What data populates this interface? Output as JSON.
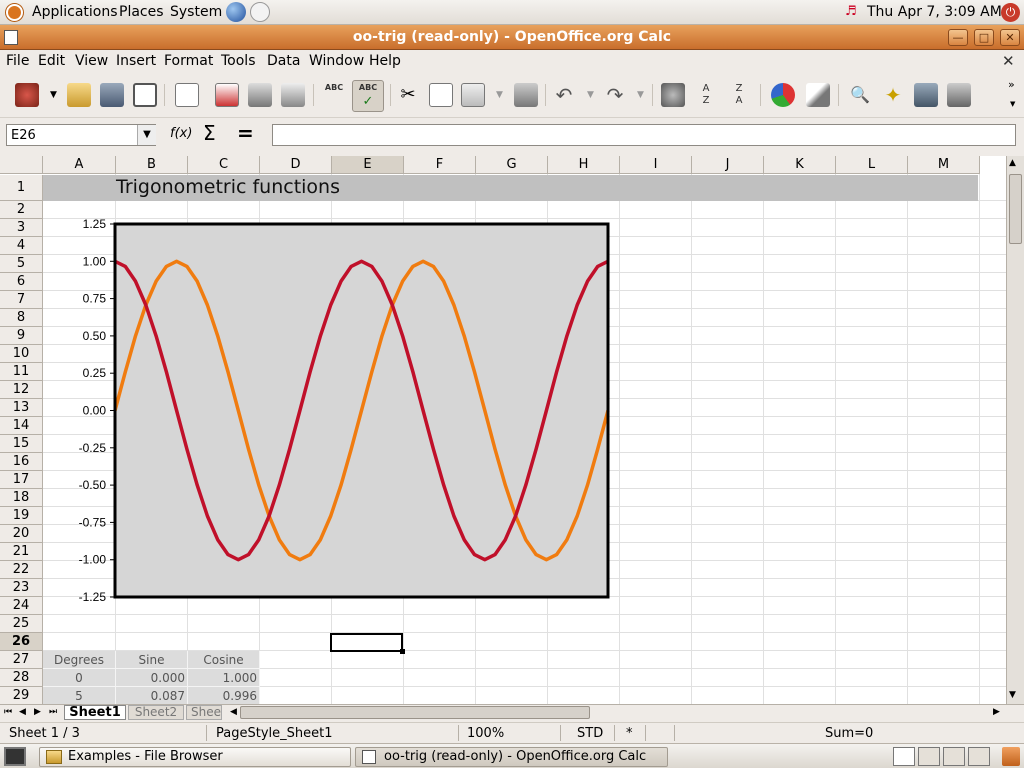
{
  "top_panel": {
    "applications": "Applications",
    "places": "Places",
    "system": "System",
    "clock": "Thu Apr  7,  3:09 AM"
  },
  "window": {
    "title": "oo-trig (read-only) - OpenOffice.org Calc"
  },
  "menu": [
    "File",
    "Edit",
    "View",
    "Insert",
    "Format",
    "Tools",
    "Data",
    "Window",
    "Help"
  ],
  "formula": {
    "name_box": "E26",
    "input_value": ""
  },
  "columns": [
    "A",
    "B",
    "C",
    "D",
    "E",
    "F",
    "G",
    "H",
    "I",
    "J",
    "K",
    "L",
    "M"
  ],
  "rows": [
    "1",
    "2",
    "3",
    "4",
    "5",
    "6",
    "7",
    "8",
    "9",
    "10",
    "11",
    "12",
    "13",
    "14",
    "15",
    "16",
    "17",
    "18",
    "19",
    "20",
    "21",
    "22",
    "23",
    "24",
    "25",
    "26",
    "27",
    "28",
    "29"
  ],
  "sheet": {
    "title": "Trigonometric functions",
    "table_headers": [
      "Degrees",
      "Sine",
      "Cosine"
    ],
    "table_rows": [
      [
        "0",
        "0.000",
        "1.000"
      ],
      [
        "5",
        "0.087",
        "0.996"
      ]
    ]
  },
  "chart_data": {
    "type": "line",
    "ylim": [
      -1.25,
      1.25
    ],
    "yticks": [
      "1.25",
      "1.00",
      "0.75",
      "0.50",
      "0.25",
      "0.00",
      "-0.25",
      "-0.50",
      "-0.75",
      "-1.00",
      "-1.25"
    ],
    "x": [
      0,
      15,
      30,
      45,
      60,
      75,
      90,
      105,
      120,
      135,
      150,
      165,
      180,
      195,
      210,
      225,
      240,
      255,
      270,
      285,
      300,
      315,
      330,
      345,
      360,
      375,
      390,
      405,
      420,
      435,
      450,
      465,
      480,
      495,
      510,
      525,
      540,
      555,
      570,
      585,
      600,
      615,
      630,
      645,
      660,
      675,
      690,
      705,
      720
    ],
    "series": [
      {
        "color": "#f07c10",
        "values": [
          0,
          0.259,
          0.5,
          0.707,
          0.866,
          0.966,
          1,
          0.966,
          0.866,
          0.707,
          0.5,
          0.259,
          0,
          -0.259,
          -0.5,
          -0.707,
          -0.866,
          -0.966,
          -1,
          -0.966,
          -0.866,
          -0.707,
          -0.5,
          -0.259,
          0,
          0.259,
          0.5,
          0.707,
          0.866,
          0.966,
          1,
          0.966,
          0.866,
          0.707,
          0.5,
          0.259,
          0,
          -0.259,
          -0.5,
          -0.707,
          -0.866,
          -0.966,
          -1,
          -0.966,
          -0.866,
          -0.707,
          -0.5,
          -0.259,
          0
        ]
      },
      {
        "color": "#c0102a",
        "values": [
          1,
          0.966,
          0.866,
          0.707,
          0.5,
          0.259,
          0,
          -0.259,
          -0.5,
          -0.707,
          -0.866,
          -0.966,
          -1,
          -0.966,
          -0.866,
          -0.707,
          -0.5,
          -0.259,
          0,
          0.259,
          0.5,
          0.707,
          0.866,
          0.966,
          1,
          0.966,
          0.866,
          0.707,
          0.5,
          0.259,
          0,
          -0.259,
          -0.5,
          -0.707,
          -0.866,
          -0.966,
          -1,
          -0.966,
          -0.866,
          -0.707,
          -0.5,
          -0.259,
          0,
          0.259,
          0.5,
          0.707,
          0.866,
          0.966,
          1
        ]
      }
    ],
    "plot_background": "#d6d6d6",
    "grid": false
  },
  "tabs": [
    "Sheet1",
    "Sheet2",
    "Shee"
  ],
  "status": {
    "sheet": "Sheet 1 / 3",
    "page_style": "PageStyle_Sheet1",
    "zoom": "100%",
    "mode": "STD",
    "modified": "*",
    "sum": "Sum=0"
  },
  "taskbar": {
    "item1": "Examples - File Browser",
    "item2": "oo-trig (read-only) - OpenOffice.org Calc"
  }
}
